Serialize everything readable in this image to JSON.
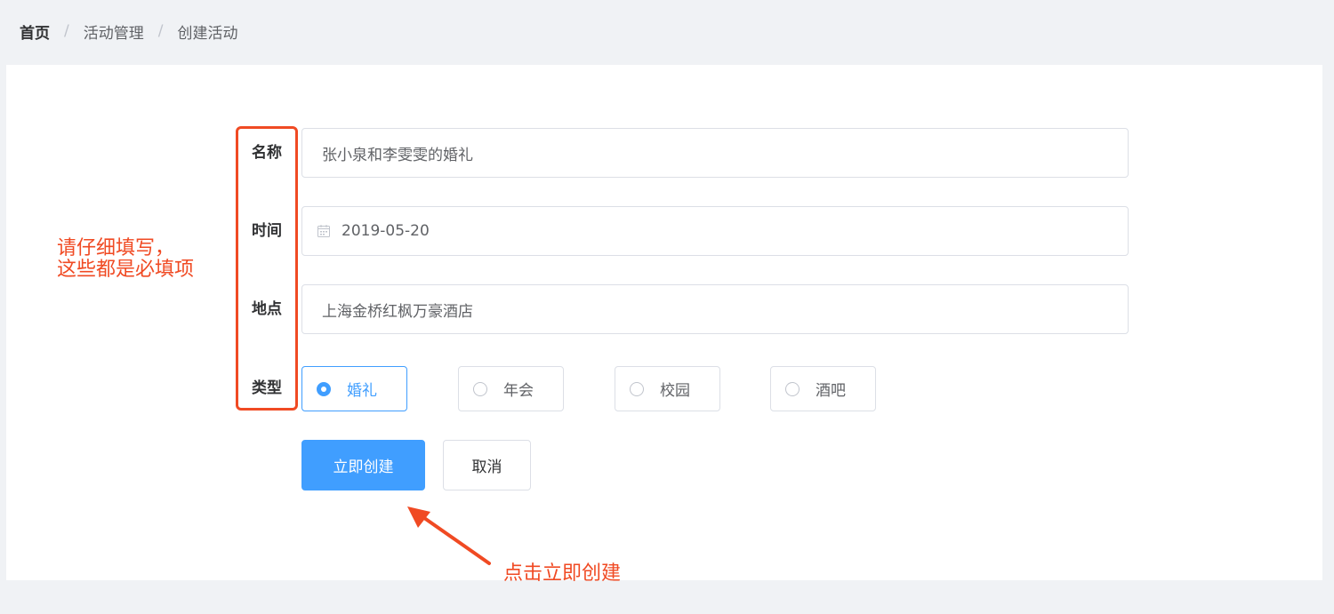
{
  "breadcrumb": [
    "首页",
    "活动管理",
    "创建活动"
  ],
  "breadcrumb_separator": "/",
  "form": {
    "name": {
      "label": "名称",
      "value": "张小泉和李雯雯的婚礼"
    },
    "time": {
      "label": "时间",
      "value": "2019-05-20",
      "icon": "calendar-icon"
    },
    "place": {
      "label": "地点",
      "value": "上海金桥红枫万豪酒店"
    },
    "type": {
      "label": "类型",
      "options": [
        "婚礼",
        "年会",
        "校园",
        "酒吧"
      ],
      "selected": "婚礼"
    }
  },
  "actions": {
    "submit_label": "立即创建",
    "cancel_label": "取消"
  },
  "annotations": {
    "left_note": "请仔细填写，\n这些都是必填项",
    "bottom_note": "点击立即创建"
  },
  "colors": {
    "primary": "#409eff",
    "annotation": "#f04a23",
    "border": "#dcdfe6",
    "background": "#f0f2f5"
  }
}
